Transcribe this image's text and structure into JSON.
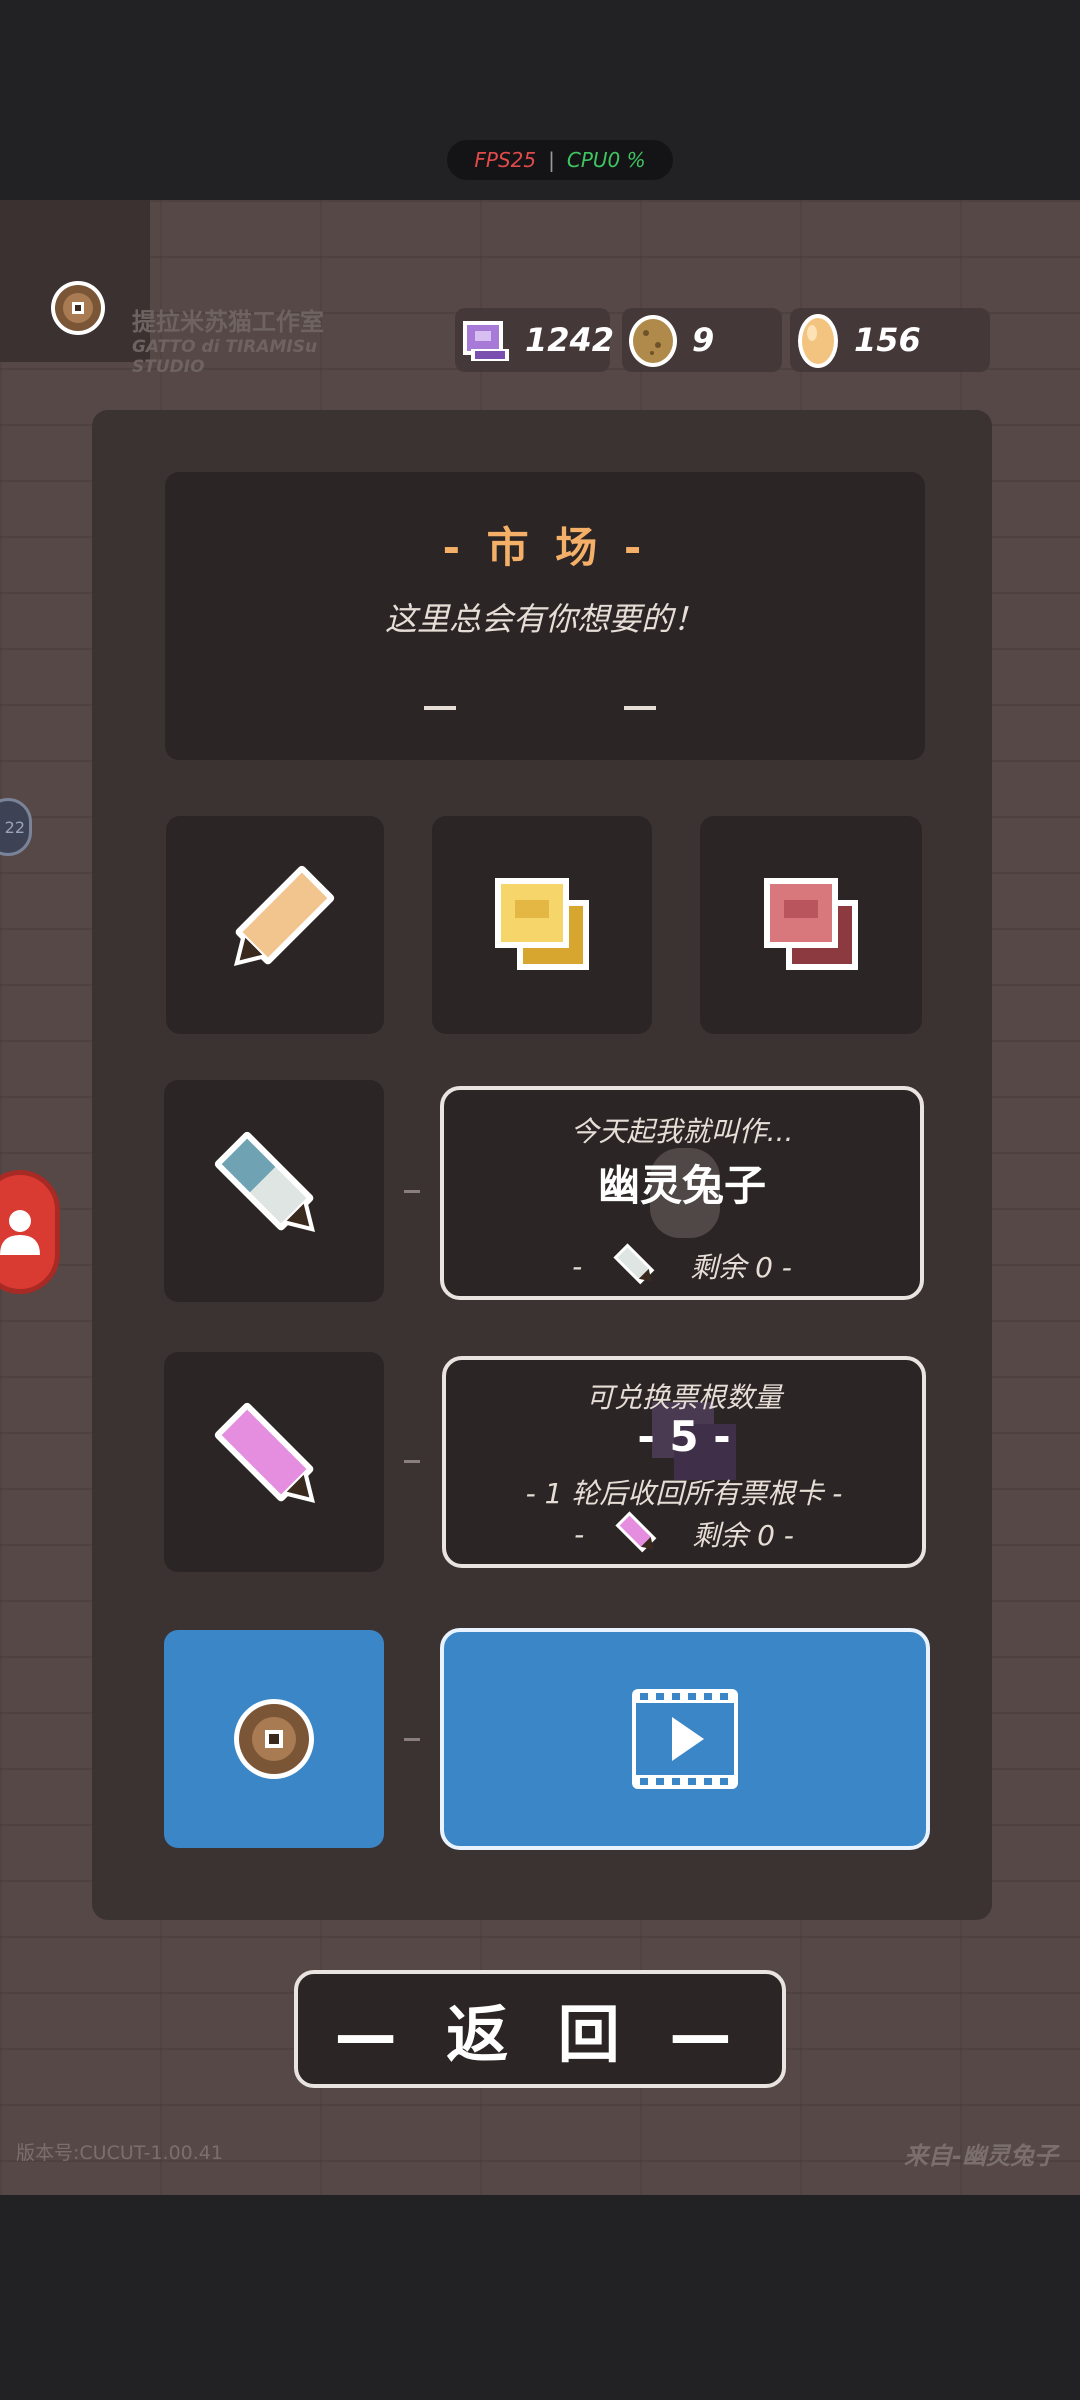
{
  "status_overlay": {
    "fps_label": "FPS25",
    "cpu_label": "CPU0 %"
  },
  "studio": {
    "name_cn": "提拉米苏猫工作室",
    "name_en_1": "GATTO di TIRAMISu",
    "name_en_2": "STUDIO"
  },
  "resources": [
    {
      "name": "ticket-stub",
      "value": "1242"
    },
    {
      "name": "potato",
      "value": "9"
    },
    {
      "name": "egg",
      "value": "156"
    }
  ],
  "market": {
    "title": "- 市 场 -",
    "subtitle": "这里总会有你想要的！"
  },
  "side": {
    "badge": "22"
  },
  "item_slots": [
    {
      "icon": "orange-pencil-icon"
    },
    {
      "icon": "yellow-ticket-stack-icon"
    },
    {
      "icon": "red-ticket-stack-icon"
    }
  ],
  "rename_card": {
    "line1": "今天起我就叫作...",
    "name": "幽灵兔子",
    "remain_prefix": "-",
    "remain": "剩余 0 -"
  },
  "exchange_card": {
    "line1": "可兑换票根数量",
    "count": "- 5 -",
    "line3": "- 1 轮后收回所有票根卡 -",
    "remain_prefix": "-",
    "remain": "剩余 0 -"
  },
  "back_button": {
    "label": "— 返 回 —"
  },
  "footer": {
    "version": "版本号:CUCUT-1.00.41",
    "from": "来自-幽灵兔子"
  },
  "colors": {
    "accent_orange": "#f4b068",
    "action_blue": "#3b86c6",
    "panel": "#3b3232",
    "card": "#2c2525"
  }
}
